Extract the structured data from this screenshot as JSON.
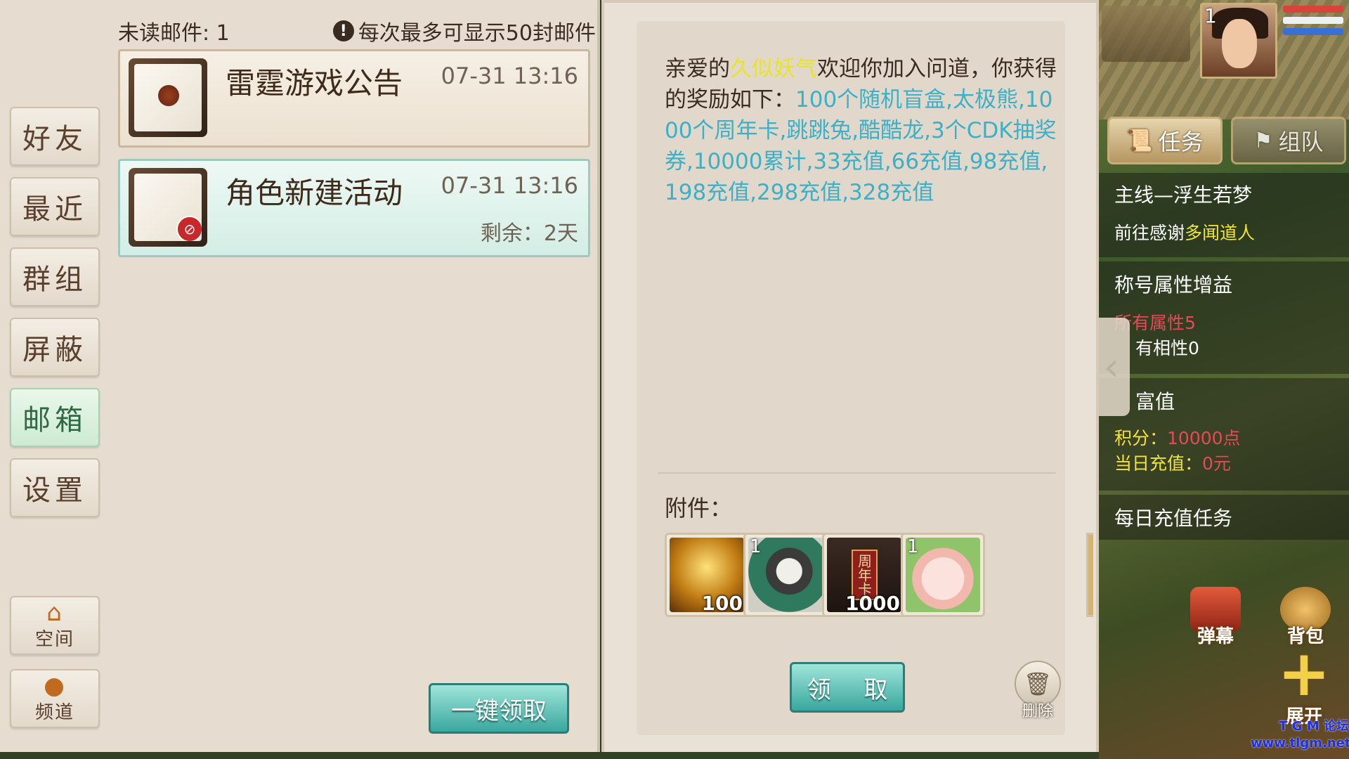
{
  "nav": {
    "items": [
      {
        "label": "好友"
      },
      {
        "label": "最近"
      },
      {
        "label": "群组"
      },
      {
        "label": "屏蔽"
      },
      {
        "label": "邮箱"
      },
      {
        "label": "设置"
      }
    ],
    "active": "邮箱",
    "space": {
      "icon": "home-icon",
      "label": "空间"
    },
    "channel": {
      "icon": "chat-bubble-icon",
      "label": "频道"
    }
  },
  "mail_list": {
    "unread_label": "未读邮件: 1",
    "limit_note": "每次最多可显示50封邮件",
    "mails": [
      {
        "title": "雷霆游戏公告",
        "time": "07-31 13:16",
        "icon": "sealed-envelope-icon"
      },
      {
        "title": "角色新建活动",
        "time": "07-31 13:16",
        "remaining": "剩余：2天",
        "icon": "letter-with-attachment-icon"
      }
    ],
    "claim_all_label": "一键领取"
  },
  "detail": {
    "greeting": "亲爱的",
    "player_name": "久似妖气",
    "welcome": "欢迎你加入问道，你获得的奖励如下：",
    "rewards": "100个随机盲盒,太极熊,1000个周年卡,跳跳兔,酷酷龙,3个CDK抽奖券,10000累计,33充值,66充值,98充值,198充值,298充值,328充值",
    "attachments_label": "附件：",
    "attachments": [
      {
        "name": "random-blind-box",
        "qty": "100"
      },
      {
        "name": "taiji-bear",
        "level": "1"
      },
      {
        "name": "anniversary-card",
        "qty": "1000",
        "card_text": "周年卡"
      },
      {
        "name": "jumping-rabbit",
        "level": "1"
      }
    ],
    "claim_label": "领 取",
    "delete_label": "删除"
  },
  "game": {
    "avatar_level": "1",
    "tabs": {
      "task": "任务",
      "team": "组队"
    },
    "tracker": {
      "main_quest_title": "主线—浮生若梦",
      "main_quest_prefix": "前往感谢",
      "main_quest_npc": "多闻道人",
      "title_bonus": "称号属性增益",
      "attr_all": "所有属性5",
      "attr_affinity": "有相性0",
      "wealth_title": "富值",
      "points_label": "积分：",
      "points_value": "10000点",
      "daily_recharge_label": "当日充值：",
      "daily_recharge_value": "0元",
      "daily_task": "每日充值任务"
    },
    "buttons": {
      "danmu": "弹幕",
      "bag": "背包",
      "expand": "展开"
    },
    "watermark": [
      "T G M 论坛",
      "www.tlgm.net"
    ]
  },
  "colors": {
    "accent_teal": "#3aa79e",
    "reward_cyan": "#3cb0c6",
    "name_yellow": "#e7e42a",
    "alert_red": "#e34a5a"
  }
}
